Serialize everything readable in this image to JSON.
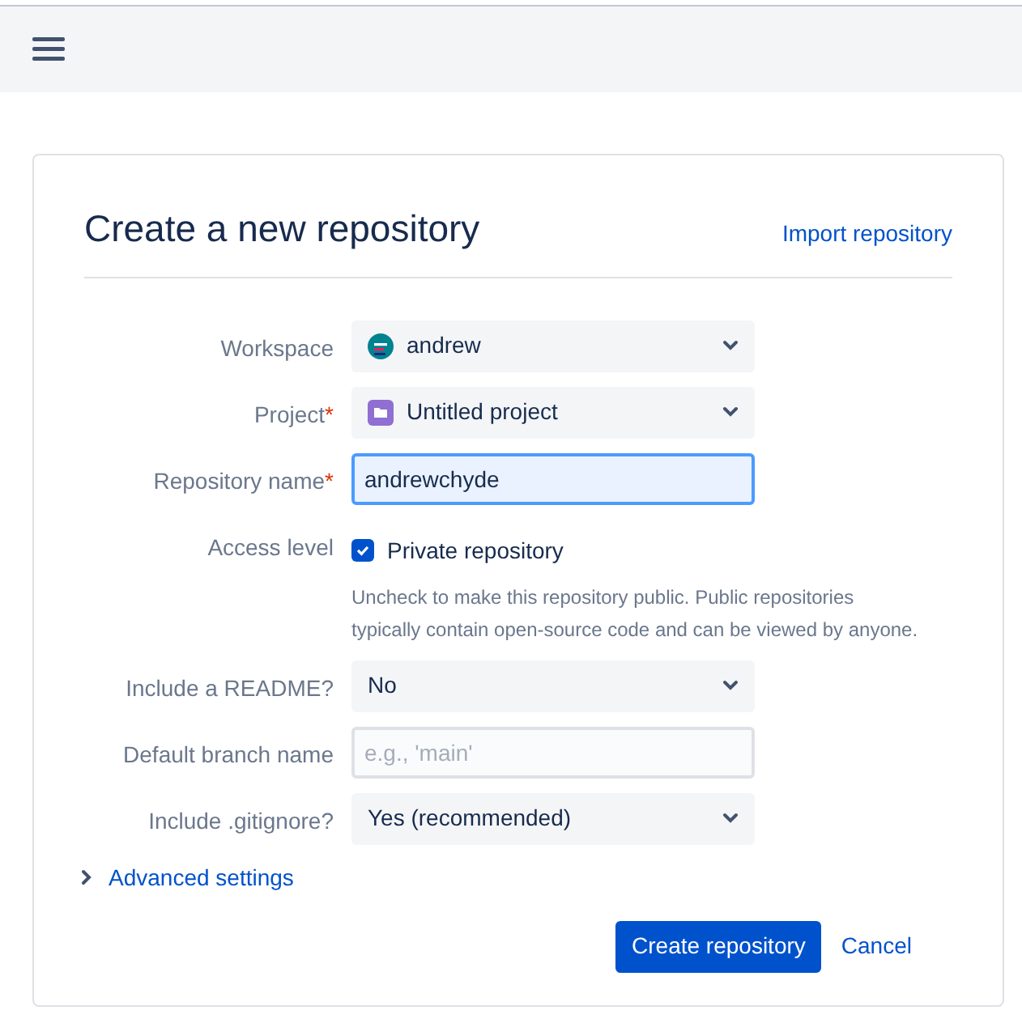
{
  "title": "Create a new repository",
  "import_link": "Import repository",
  "fields": [
    {
      "kind": "select",
      "label": "Workspace",
      "value": "andrew"
    },
    {
      "kind": "select",
      "label": "Project",
      "required_mark": "*",
      "value": "Untitled project"
    },
    {
      "kind": "input",
      "label": "Repository name",
      "required_mark": "*",
      "value": "andrewchyde",
      "focused": true
    },
    {
      "kind": "checkbox",
      "label": "Access level",
      "option": "Private repository",
      "checked": true,
      "help": "Uncheck to make this repository public. Public repositories typically contain open-source code and can be viewed by anyone."
    },
    {
      "kind": "select",
      "label": "Include a README?",
      "value": "No"
    },
    {
      "kind": "input",
      "label": "Default branch name",
      "placeholder": "e.g., 'main'",
      "focused": false
    },
    {
      "kind": "select",
      "label": "Include .gitignore?",
      "value": "Yes (recommended)"
    }
  ],
  "advanced": {
    "label": "Advanced settings",
    "expanded": false
  },
  "buttons": {
    "primary": "Create repository",
    "cancel": "Cancel"
  }
}
